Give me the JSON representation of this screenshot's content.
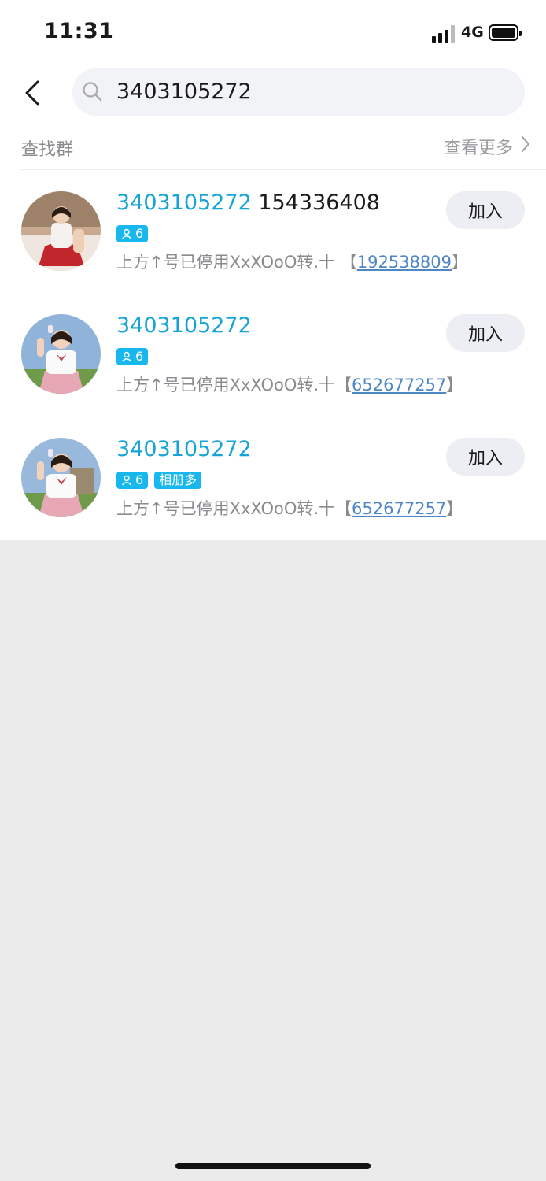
{
  "status_bar": {
    "time": "11:31",
    "network": "4G"
  },
  "search": {
    "query": "3403105272"
  },
  "section": {
    "title": "查找群",
    "more_label": "查看更多"
  },
  "results": [
    {
      "name_highlight": "3403105272",
      "name_rest": " 154336408",
      "member_count": "6",
      "tag2": "",
      "desc_prefix": "上方↑号已停用XxXOoO转.十 【",
      "desc_link": "192538809",
      "desc_suffix": "】",
      "join_label": "加入"
    },
    {
      "name_highlight": "3403105272",
      "name_rest": "",
      "member_count": "6",
      "tag2": "",
      "desc_prefix": "上方↑号已停用XxXOoO转.十【",
      "desc_link": "652677257",
      "desc_suffix": "】",
      "join_label": "加入"
    },
    {
      "name_highlight": "3403105272",
      "name_rest": "",
      "member_count": "6",
      "tag2": "相册多",
      "desc_prefix": "上方↑号已停用XxXOoO转.十【",
      "desc_link": "652677257",
      "desc_suffix": "】",
      "join_label": "加入"
    }
  ],
  "colors": {
    "highlight": "#14a4d8",
    "tag_bg": "#18b8ee",
    "link": "#4f86c6",
    "join_bg": "#eceef3",
    "page_bg": "#ebebeb"
  },
  "icons": [
    "back-arrow-icon",
    "search-icon",
    "chevron-right-icon",
    "person-icon",
    "signal-icon",
    "battery-icon"
  ]
}
